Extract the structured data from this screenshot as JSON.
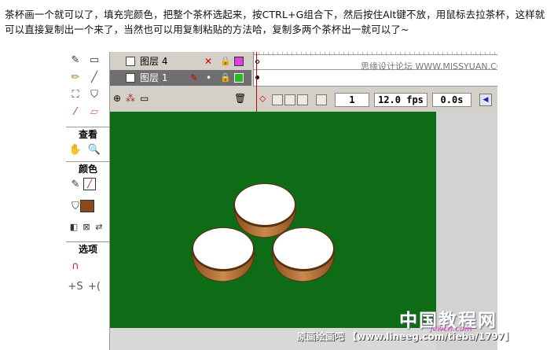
{
  "article": {
    "text": "茶杯画一个就可以了，填充完颜色，把整个茶杯选起来，按CTRL+G组合下，然后按住Alt键不放，用鼠标去拉茶杯，这样就可以直接复制出一个来了，当然也可以用复制粘贴的方法哈，复制多两个茶杯出一就可以了~"
  },
  "tools_panel": {
    "view_label": "查看",
    "color_label": "颜色",
    "options_label": "选项"
  },
  "timeline": {
    "layers": [
      {
        "name": "图层 4",
        "outline_color": "#e040e0"
      },
      {
        "name": "图层 1",
        "outline_color": "#22bb22"
      }
    ],
    "current_frame": "1",
    "frame_rate": "12.0 fps",
    "elapsed_time": "0.0s"
  },
  "watermarks": {
    "top": "思缘设计论坛 WWW.MISSYUAN.COM",
    "footer": "原画绘画吧  【www.lineeg.com/tieba/1797】",
    "big": "中国教程网",
    "url": "jcwcn.com"
  },
  "colors": {
    "stage": "#0e6c16",
    "cup_body": "#b0703a",
    "cup_top": "#ffffff"
  }
}
